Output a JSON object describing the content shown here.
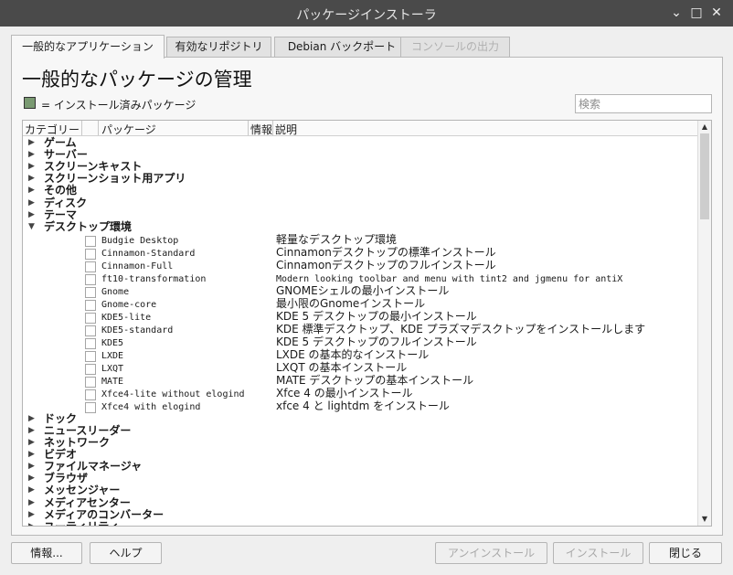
{
  "window": {
    "title": "パッケージインストーラ",
    "minimize": "⌄",
    "maximize": "□",
    "close": "✕"
  },
  "tabs": [
    {
      "label": "一般的なアプリケーション"
    },
    {
      "label": "有効なリポジトリ"
    },
    {
      "label": "Debian バックポート"
    },
    {
      "label": "コンソールの出力"
    }
  ],
  "main": {
    "heading": "一般的なパッケージの管理",
    "legend_text": "= インストール済みパッケージ",
    "search_placeholder": "検索"
  },
  "tree": {
    "columns": [
      "カテゴリー",
      "パッケージ",
      "情報",
      "説明"
    ],
    "categories_before": [
      "ゲーム",
      "サーバー",
      "スクリーンキャスト",
      "スクリーンショット用アプリ",
      "その他",
      "ディスク",
      "テーマ"
    ],
    "expanded_category": "デスクトップ環境",
    "packages": [
      {
        "name": "Budgie Desktop",
        "desc": "軽量なデスクトップ環境"
      },
      {
        "name": "Cinnamon-Standard",
        "desc": "Cinnamonデスクトップの標準インストール"
      },
      {
        "name": "Cinnamon-Full",
        "desc": "Cinnamonデスクトップのフルインストール"
      },
      {
        "name": "ft10-transformation",
        "desc": "Modern looking toolbar and menu with tint2 and jgmenu for antiX"
      },
      {
        "name": "Gnome",
        "desc": "GNOMEシェルの最小インストール"
      },
      {
        "name": "Gnome-core",
        "desc": "最小限のGnomeインストール"
      },
      {
        "name": "KDE5-lite",
        "desc": "KDE 5 デスクトップの最小インストール"
      },
      {
        "name": "KDE5-standard",
        "desc": "KDE 標準デスクトップ、KDE プラズマデスクトップをインストールします"
      },
      {
        "name": "KDE5",
        "desc": "KDE 5 デスクトップのフルインストール"
      },
      {
        "name": "LXDE",
        "desc": "LXDE の基本的なインストール"
      },
      {
        "name": "LXQT",
        "desc": "LXQT の基本インストール"
      },
      {
        "name": "MATE",
        "desc": "MATE デスクトップの基本インストール"
      },
      {
        "name": "Xfce4-lite without elogind",
        "desc": "Xfce 4 の最小インストール"
      },
      {
        "name": "Xfce4 with elogind",
        "desc": "xfce 4 と lightdm をインストール"
      }
    ],
    "categories_after": [
      "ドック",
      "ニュースリーダー",
      "ネットワーク",
      "ビデオ",
      "ファイルマネージャ",
      "ブラウザ",
      "メッセンジャー",
      "メディアセンター",
      "メディアのコンバーター",
      "ユーティリティ"
    ]
  },
  "buttons": {
    "info": "情報...",
    "help": "ヘルプ",
    "uninstall": "アンインストール",
    "install": "インストール",
    "close": "閉じる"
  },
  "colors": {
    "installed_swatch": "#7a9a72",
    "titlebar": "#4a4a4a"
  }
}
